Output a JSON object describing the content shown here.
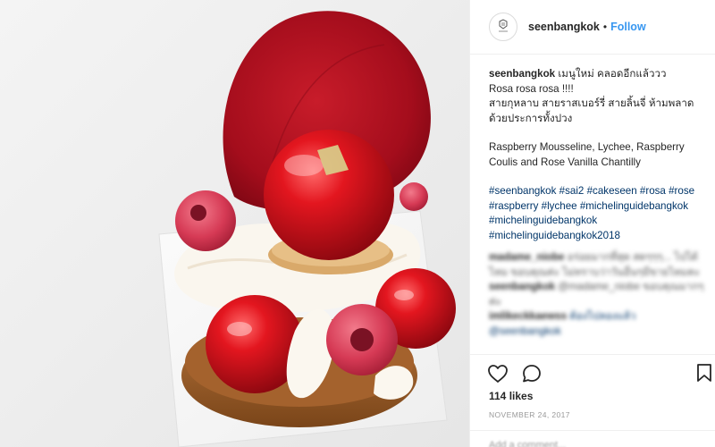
{
  "post": {
    "username": "seenbangkok",
    "separator": "•",
    "follow_label": "Follow",
    "caption_user": "seenbangkok",
    "caption_lines": [
      "เมนูใหม่ คลอดอีกแล้ววว",
      "Rosa rosa rosa !!!!",
      "สายกุหลาบ สายราสเบอร์รี่ สายลิ้นจี่ ห้ามพลาด",
      "ด้วยประการทั้งปวง"
    ],
    "description": "Raspberry Mousseline, Lychee, Raspberry Coulis and Rose Vanilla Chantilly",
    "hashtags": "#seenbangkok #sai2 #cakeseen #rosa #rose #raspberry #lychee #michelinguidebangkok #michelinguidebangkok #michelinguidebangkok2018",
    "likes": "114 likes",
    "date": "NOVEMBER 24, 2017"
  },
  "blurred_comments": [
    {
      "user": "madame_niobe",
      "text": "อร่อยมากที่สุด สดๆๆๆ... ไปได้ไหม ขอบคุณค่ะ ไม่ทราบว่าวันอื่นๆมีขายไหมคะ"
    },
    {
      "user": "seenbangkok",
      "text": "@madame_niobe ขอบคุณมากๆค่ะ"
    },
    {
      "user": "imlikeckkaewss",
      "text": "ต้องไปลองแล้ว @seenbangkok"
    }
  ],
  "add_comment_placeholder": "Add a comment...",
  "colors": {
    "follow": "#3897f0",
    "hashtag": "#003569",
    "text": "#262626",
    "muted": "#999999",
    "rose_petal": "#b0101f",
    "raspberry_glaze": "#d5141c"
  },
  "icons": [
    "heart-icon",
    "comment-icon",
    "bookmark-icon"
  ]
}
